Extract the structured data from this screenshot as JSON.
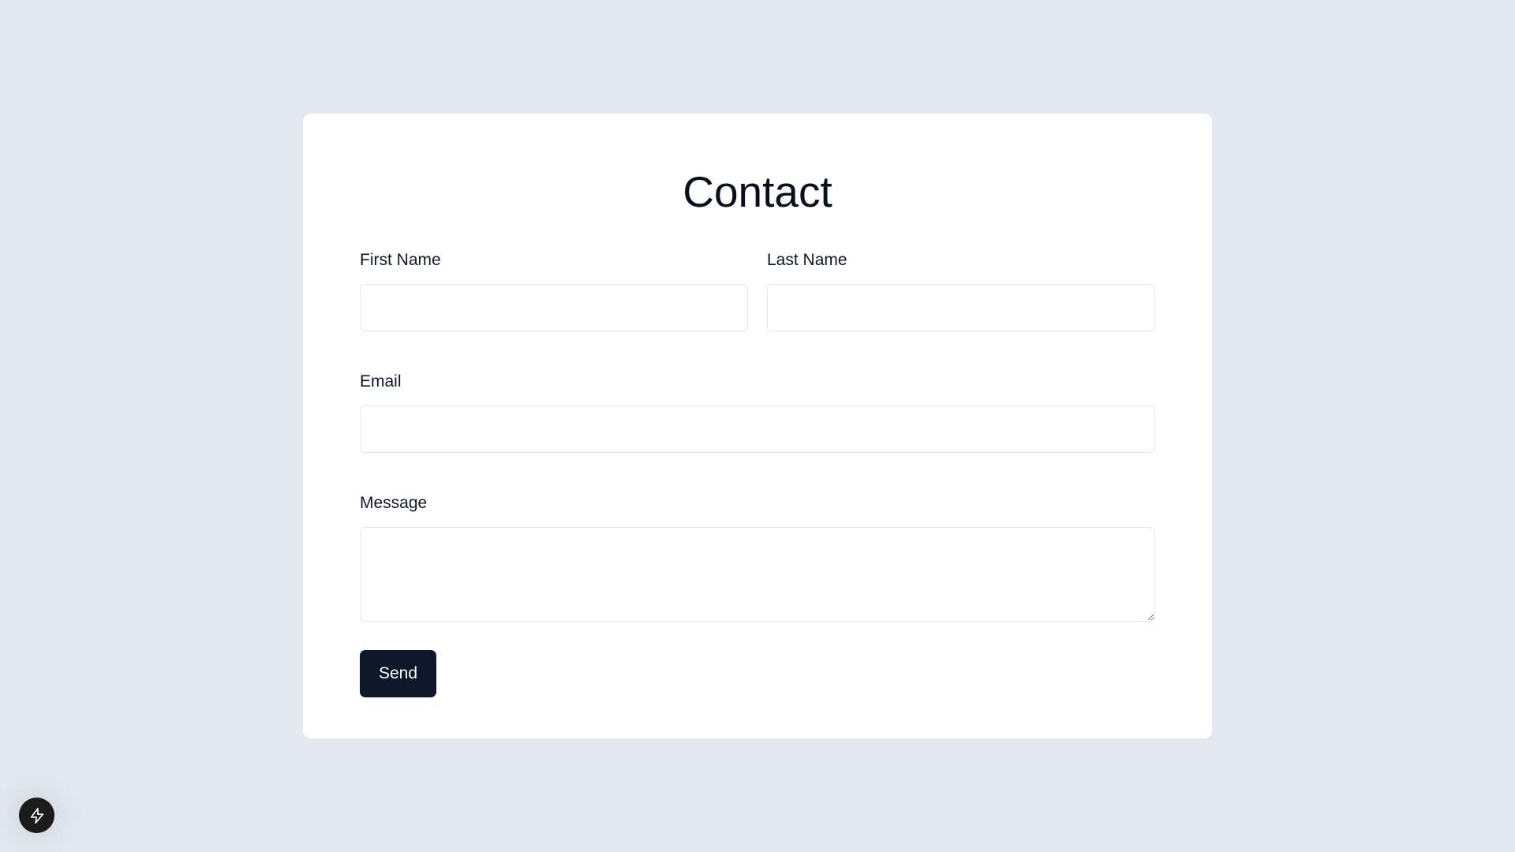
{
  "form": {
    "title": "Contact",
    "first_name": {
      "label": "First Name",
      "value": "",
      "placeholder": ""
    },
    "last_name": {
      "label": "Last Name",
      "value": "",
      "placeholder": ""
    },
    "email": {
      "label": "Email",
      "value": "",
      "placeholder": ""
    },
    "message": {
      "label": "Message",
      "value": "",
      "placeholder": ""
    },
    "submit_label": "Send"
  },
  "dev_tools_button": {
    "icon": "lightning-bolt-icon"
  },
  "colors": {
    "background": "#e2e8f0",
    "card": "#ffffff",
    "button": "#0f172a",
    "button_text": "#ffffff",
    "input_border": "#e2e8f0",
    "fab": "#1b1b1b"
  }
}
